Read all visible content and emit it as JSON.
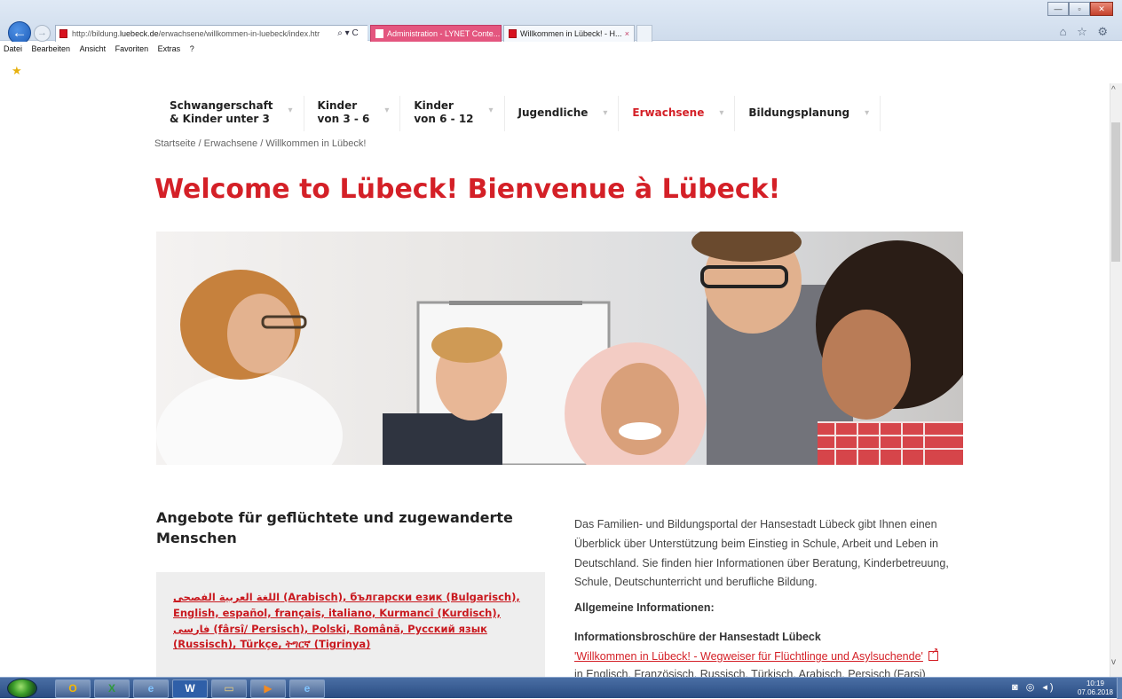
{
  "browser": {
    "url_prefix": "http://bildung.",
    "url_domain": "luebeck.de",
    "url_path": "/erwachsene/willkommen-in-luebeck/index.htr",
    "addr_buttons": "⌕ ▾ C",
    "tabs": [
      {
        "title": "Administration - LYNET Conte..."
      },
      {
        "title": "Willkommen in Lübeck! - H..."
      }
    ],
    "tab_close": "×",
    "tool_icons": "⌂ ☆ ⚙",
    "menu": [
      "Datei",
      "Bearbeiten",
      "Ansicht",
      "Favoriten",
      "Extras",
      "?"
    ],
    "window_buttons": [
      "—",
      "▫",
      "✕"
    ]
  },
  "site": {
    "nav": [
      {
        "line1": "Schwangerschaft",
        "line2": "& Kinder unter 3"
      },
      {
        "line1": "Kinder",
        "line2": "von 3 - 6"
      },
      {
        "line1": "Kinder",
        "line2": "von 6 - 12"
      },
      {
        "line1": "Jugendliche",
        "line2": ""
      },
      {
        "line1": "Erwachsene",
        "line2": ""
      },
      {
        "line1": "Bildungsplanung",
        "line2": ""
      }
    ],
    "caret": "▾",
    "breadcrumb": "Startseite  /  Erwachsene  /  Willkommen in Lübeck!",
    "title": "Welcome to Lübeck! Bienvenue à Lübeck!",
    "section_heading": "Angebote für geflüchtete und zugewanderte Menschen",
    "language_links": "اللغة العربية الفصحى (Arabisch), български език (Bulgarisch), English, español, français, italiano, Kurmancî (Kurdisch), فارسی (fârsî/ Persisch), Polski, Română, Русский язык (Russisch), Türkçe, ትግርኛ (Tigrinya)",
    "intro": "Das Familien- und Bildungsportal der Hansestadt Lübeck gibt Ihnen einen Überblick über  Unterstützung beim Einstieg in Schule, Arbeit und Leben in Deutschland. Sie finden hier Informationen über Beratung, Kinderbetreuung, Schule, Deutschunterricht und berufliche Bildung.",
    "general_info_heading": "Allgemeine Informationen:",
    "brochure_heading": "Informationsbroschüre der Hansestadt Lübeck",
    "brochure_link": "'Willkommen in Lübeck! - Wegweiser für Flüchtlinge und Asylsuchende'",
    "brochure_languages": "in Englisch, Französisch, Russisch, Türkisch, Arabisch, Persisch (Farsi)"
  },
  "taskbar": {
    "apps": [
      {
        "icon": "outlook-icon",
        "glyph": "O"
      },
      {
        "icon": "excel-icon",
        "glyph": "X"
      },
      {
        "icon": "internet-explorer-icon",
        "glyph": "e"
      },
      {
        "icon": "word-icon",
        "glyph": "W"
      },
      {
        "icon": "folder-icon",
        "glyph": "▭"
      },
      {
        "icon": "media-player-icon",
        "glyph": "▶"
      },
      {
        "icon": "internet-explorer-icon",
        "glyph": "e"
      }
    ],
    "tray_icons": "◙ ◎ ◂)",
    "time": "10:19",
    "date": "07.06.2018"
  },
  "colors": {
    "brand_red": "#d42027",
    "tab_active_pink": "#e4567f",
    "taskbar_blue": "#2a4c82"
  }
}
